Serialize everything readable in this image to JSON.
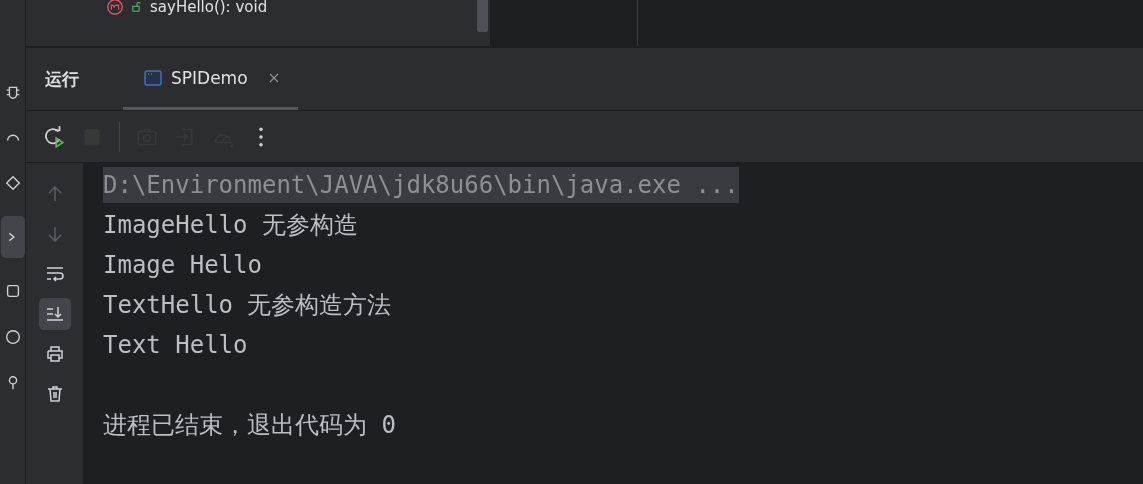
{
  "structure": {
    "item": {
      "label": "sayHello(): void"
    }
  },
  "run_panel": {
    "title": "运行",
    "tabs": [
      {
        "label": "SPIDemo",
        "selected": true
      }
    ],
    "toolbar": [
      {
        "kind": "rerun",
        "disabled": false
      },
      {
        "kind": "stop",
        "disabled": true
      },
      {
        "kind": "separator"
      },
      {
        "kind": "camera",
        "disabled": true
      },
      {
        "kind": "exit",
        "disabled": true
      },
      {
        "kind": "gauge",
        "disabled": true
      },
      {
        "kind": "more",
        "disabled": false
      }
    ],
    "side_tools": [
      {
        "kind": "up",
        "on": false,
        "disabled": true
      },
      {
        "kind": "down",
        "on": false,
        "disabled": true
      },
      {
        "kind": "wrap",
        "on": false,
        "disabled": false
      },
      {
        "kind": "scroll_end",
        "on": true,
        "disabled": false
      },
      {
        "kind": "print",
        "on": false,
        "disabled": false
      },
      {
        "kind": "trash",
        "on": false,
        "disabled": false
      }
    ],
    "console": [
      {
        "kind": "command",
        "text": "D:\\Environment\\JAVA\\jdk8u66\\bin\\java.exe ..."
      },
      {
        "kind": "output",
        "text": "ImageHello 无参构造"
      },
      {
        "kind": "output",
        "text": "Image Hello"
      },
      {
        "kind": "output",
        "text": "TextHello 无参构造方法"
      },
      {
        "kind": "output",
        "text": "Text Hello"
      },
      {
        "kind": "exit",
        "text": "进程已结束，退出代码为 0"
      }
    ]
  }
}
